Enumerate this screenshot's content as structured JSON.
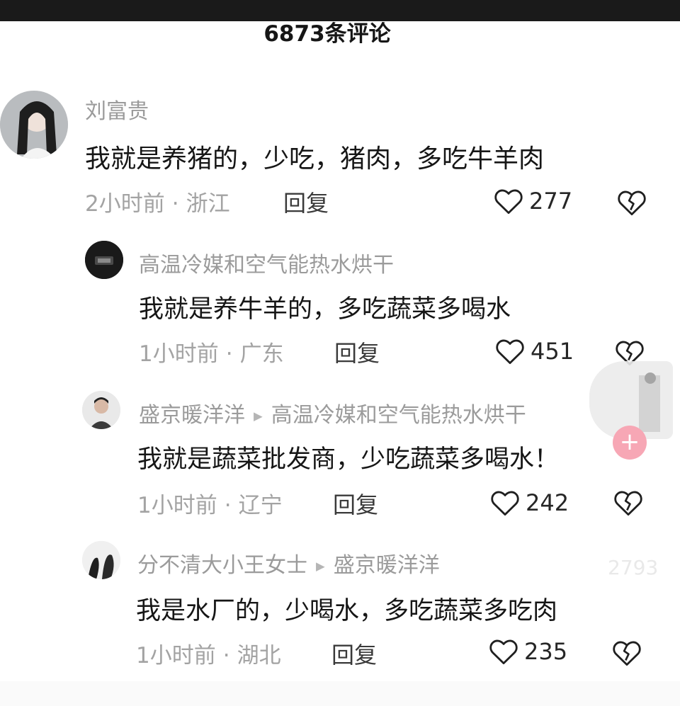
{
  "header": {
    "title": "6873条评论"
  },
  "comments": [
    {
      "username": "刘富贵",
      "text": "我就是养猪的，少吃，猪肉，多吃牛羊肉",
      "time": "2小时前",
      "location": "浙江",
      "reply_label": "回复",
      "likes": "277",
      "reply_to": ""
    },
    {
      "username": "高温冷媒和空气能热水烘干",
      "text": "我就是养牛羊的，多吃蔬菜多喝水",
      "time": "1小时前",
      "location": "广东",
      "reply_label": "回复",
      "likes": "451",
      "reply_to": ""
    },
    {
      "username": "盛京暖洋洋",
      "text": "我就是蔬菜批发商，少吃蔬菜多喝水！",
      "time": "1小时前",
      "location": "辽宁",
      "reply_label": "回复",
      "likes": "242",
      "reply_to": "高温冷媒和空气能热水烘干"
    },
    {
      "username": "分不清大小王女士",
      "text": "我是水厂的，少喝水，多吃蔬菜多吃肉",
      "time": "1小时前",
      "location": "湖北",
      "reply_label": "回复",
      "likes": "235",
      "reply_to": "盛京暖洋洋"
    }
  ],
  "overlay": {
    "plus_label": "+",
    "faded_count": "2793"
  },
  "icons": {
    "like": "heart-outline-icon",
    "dislike": "broken-heart-icon",
    "reply_arrow": "triangle-right-icon"
  },
  "colors": {
    "text": "#161616",
    "meta": "#a3a3a3",
    "accent_pink": "#f7a7b5"
  }
}
